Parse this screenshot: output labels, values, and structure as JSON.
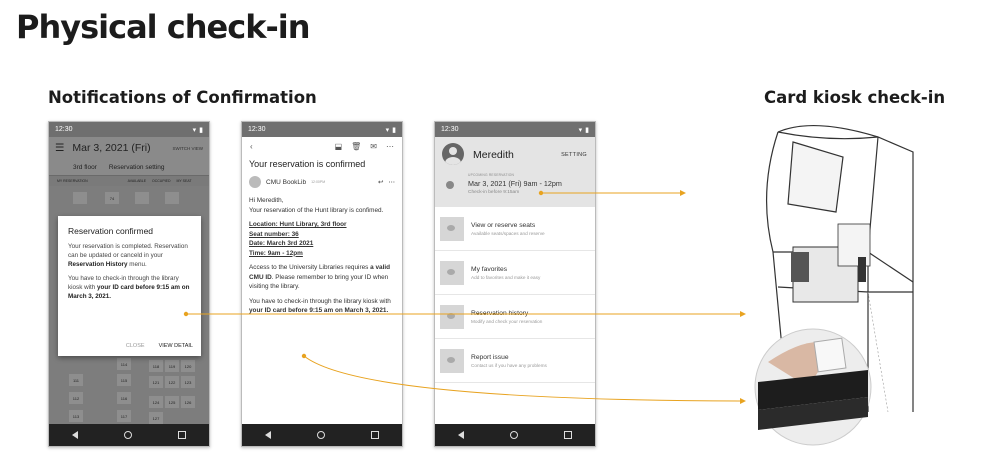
{
  "page": {
    "title": "Physical check-in",
    "section_notifications": "Notifications of Confirmation",
    "section_kiosk": "Card kiosk check-in"
  },
  "colors": {
    "accent": "#e8a320",
    "dark": "#222222"
  },
  "phone1": {
    "time": "12:30",
    "date": "Mar 3, 2021 (Fri)",
    "switch_view": "SWITCH VIEW",
    "floor": "3rd floor",
    "seating": "Reservation setting",
    "legend": [
      "MY RESERVATION",
      "AVAILABLE",
      "OCCUPIED",
      "MY SEAT"
    ],
    "seats": [
      "74",
      "111",
      "112",
      "113",
      "114",
      "115",
      "116",
      "117",
      "118",
      "119",
      "120",
      "121",
      "122",
      "123",
      "124",
      "125",
      "126",
      "127"
    ],
    "dialog": {
      "title": "Reservation confirmed",
      "p1_a": "Your reservation is completed. Reservation can be updated or canceld in your ",
      "p1_b": "Reservation History",
      "p1_c": " menu.",
      "p2_a": "You have to check-in through the library kiosk with ",
      "p2_b": "your ID card before 9:15 am on March 3, 2021.",
      "close": "CLOSE",
      "view_detail": "VIEW DETAIL"
    }
  },
  "phone2": {
    "time": "12:30",
    "subject": "Your reservation is confirmed",
    "sender": "CMU BookLib",
    "sent_time": "12:00PM",
    "greeting": "Hi Meredith,",
    "intro": "Your reservation of the Hunt library is confimed.",
    "location": "Location: Hunt Library, 3rd floor",
    "seat": "Seat number: 36",
    "date": "Date: March 3rd 2021",
    "time_slot": "Time: 9am - 12pm",
    "access_a": "Access to the University Libraries requires ",
    "access_b": "a valid CMU ID",
    "access_c": ". Please remember to bring your ID when visiting the library.",
    "checkin_a": "You have to check-in through the library kiosk with ",
    "checkin_b": "your ID card before 9:15 am on March 3, 2021."
  },
  "phone3": {
    "time": "12:30",
    "name": "Meredith",
    "setting": "SETTING",
    "upcoming_label": "UPCOMING RESERVATION",
    "upcoming_date": "Mar 3, 2021 (Fri)   9am - 12pm",
    "checkin_note": "Check-in before 9:15am",
    "menu": [
      {
        "title": "View or reserve seats",
        "sub": "Available seats/spaces and reserve"
      },
      {
        "title": "My favorites",
        "sub": "Add to favorites and make it easy"
      },
      {
        "title": "Reservation history",
        "sub": "Modify and check your reservation"
      },
      {
        "title": "Report issue",
        "sub": "Contact us if you have any problems"
      }
    ]
  }
}
